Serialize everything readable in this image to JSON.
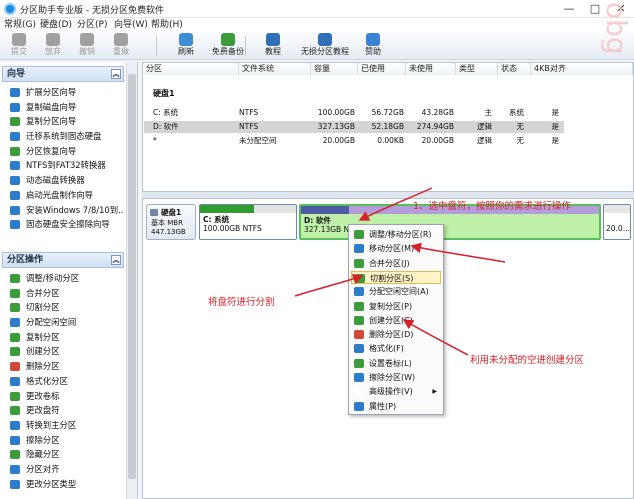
{
  "window": {
    "title": "分区助手专业版 - 无损分区免费软件",
    "controls": [
      "—",
      "□",
      "✕"
    ]
  },
  "menu": [
    "常规(G)",
    "硬盘(D)",
    "分区(P)",
    "向导(W)",
    "帮助(H)"
  ],
  "toolbar": {
    "buttons": [
      {
        "label": "提交",
        "icon": "commit-icon",
        "color": "#a0a0a0",
        "disabled": true
      },
      {
        "label": "放弃",
        "icon": "discard-icon",
        "color": "#a0a0a0",
        "disabled": true
      },
      {
        "label": "撤销",
        "icon": "undo-icon",
        "color": "#a0a0a0",
        "disabled": true
      },
      {
        "label": "重做",
        "icon": "redo-icon",
        "color": "#a0a0a0",
        "disabled": true
      },
      {
        "label": "刷新",
        "icon": "refresh-icon",
        "color": "#3a8fd6",
        "disabled": false
      },
      {
        "label": "免费备份",
        "icon": "backup-icon",
        "color": "#3c9c3c",
        "disabled": false
      },
      {
        "label": "教程",
        "icon": "tutorial-icon",
        "color": "#2f6fb5",
        "disabled": false
      },
      {
        "label": "无损分区教程",
        "icon": "partition-tutorial-icon",
        "color": "#2f6fb5",
        "disabled": false
      },
      {
        "label": "赞助",
        "icon": "heart-icon",
        "color": "#3b82d4",
        "disabled": false
      }
    ]
  },
  "sidebar": {
    "wizard_title": "向导",
    "wizard_items": [
      {
        "label": "扩展分区向导",
        "color": "#2b7cc9"
      },
      {
        "label": "复制磁盘向导",
        "color": "#2b7cc9"
      },
      {
        "label": "复制分区向导",
        "color": "#3c9c3c"
      },
      {
        "label": "迁移系统到固态硬盘",
        "color": "#2b7cc9"
      },
      {
        "label": "分区恢复向导",
        "color": "#3c9c3c"
      },
      {
        "label": "NTFS到FAT32转换器",
        "color": "#2b7cc9"
      },
      {
        "label": "动态磁盘转换器",
        "color": "#2b7cc9"
      },
      {
        "label": "启动光盘制作向导",
        "color": "#2b7cc9"
      },
      {
        "label": "安装Windows 7/8/10到...",
        "color": "#2b7cc9"
      },
      {
        "label": "固态硬盘安全擦除向导",
        "color": "#2b7cc9"
      }
    ],
    "ops_title": "分区操作",
    "ops_items": [
      {
        "label": "调整/移动分区",
        "color": "#3c9c3c"
      },
      {
        "label": "合并分区",
        "color": "#3c9c3c"
      },
      {
        "label": "切割分区",
        "color": "#3c9c3c"
      },
      {
        "label": "分配空闲空间",
        "color": "#2b7cc9"
      },
      {
        "label": "复制分区",
        "color": "#3c9c3c"
      },
      {
        "label": "创建分区",
        "color": "#3c9c3c"
      },
      {
        "label": "删除分区",
        "color": "#d04a3a"
      },
      {
        "label": "格式化分区",
        "color": "#2b7cc9"
      },
      {
        "label": "更改卷标",
        "color": "#3c9c3c"
      },
      {
        "label": "更改盘符",
        "color": "#3c9c3c"
      },
      {
        "label": "转换到主分区",
        "color": "#2b7cc9"
      },
      {
        "label": "擦除分区",
        "color": "#2b7cc9"
      },
      {
        "label": "隐藏分区",
        "color": "#3c9c3c"
      },
      {
        "label": "分区对齐",
        "color": "#2b7cc9"
      },
      {
        "label": "更改分区类型",
        "color": "#2b7cc9"
      }
    ]
  },
  "table": {
    "columns": [
      "分区",
      "文件系统",
      "容量",
      "已使用",
      "未使用",
      "类型",
      "状态",
      "4KB对齐"
    ],
    "disk_label": "硬盘1",
    "rows": [
      {
        "name": "C: 系统",
        "fs": "NTFS",
        "capacity": "100.00GB",
        "used": "56.72GB",
        "free": "43.28GB",
        "type": "主",
        "status": "系统",
        "align": "是"
      },
      {
        "name": "D: 软件",
        "fs": "NTFS",
        "capacity": "327.13GB",
        "used": "52.18GB",
        "free": "274.94GB",
        "type": "逻辑",
        "status": "无",
        "align": "是"
      },
      {
        "name": "*",
        "fs": "未分配空间",
        "capacity": "20.00GB",
        "used": "0.00KB",
        "free": "20.00GB",
        "type": "逻辑",
        "status": "无",
        "align": "是"
      }
    ]
  },
  "disk_map": {
    "disk_name": "硬盘1",
    "disk_type": "基本 MBR",
    "disk_size": "447.13GB",
    "partitions": [
      {
        "name": "C: 系统",
        "desc": "100.00GB NTFS",
        "used_fraction": 0.567,
        "bar_color": "#2f9e2f"
      },
      {
        "name": "D: 软件",
        "desc": "327.13GB NTFS",
        "used_fraction": 0.16,
        "bar_color": "#4b5ca3"
      },
      {
        "name": "",
        "desc": "20.0...",
        "used_fraction": 0.0,
        "bar_color": "#d8d8d8"
      }
    ]
  },
  "context_menu": [
    {
      "label": "调整/移动分区(R)",
      "icon": "resize-icon",
      "color": "#3c9c3c"
    },
    {
      "label": "移动分区(M)",
      "icon": "move-icon",
      "color": "#2b7cc9"
    },
    {
      "label": "合并分区(J)",
      "icon": "merge-icon",
      "color": "#3c9c3c"
    },
    {
      "label": "切割分区(S)",
      "icon": "split-icon",
      "color": "#3c9c3c"
    },
    {
      "label": "分配空闲空间(A)",
      "icon": "allocate-icon",
      "color": "#2b7cc9"
    },
    {
      "label": "复制分区(P)",
      "icon": "copy-icon",
      "color": "#3c9c3c"
    },
    {
      "label": "创建分区(C)",
      "icon": "create-icon",
      "color": "#3c9c3c"
    },
    {
      "label": "删除分区(D)",
      "icon": "delete-icon",
      "color": "#d04a3a"
    },
    {
      "label": "格式化(F)",
      "icon": "format-icon",
      "color": "#2b7cc9"
    },
    {
      "label": "设置卷标(L)",
      "icon": "label-icon",
      "color": "#3c9c3c"
    },
    {
      "label": "擦除分区(W)",
      "icon": "wipe-icon",
      "color": "#2b7cc9"
    },
    {
      "label": "高级操作(V)",
      "icon": "advanced-icon",
      "color": "#ffffff",
      "submenu": true
    },
    {
      "label": "属性(P)",
      "icon": "info-icon",
      "color": "#2b7cc9"
    }
  ],
  "annotations": {
    "step1": "1、选中盘符，按照你的需求进行操作",
    "split": "将盘符进行分割",
    "create": "利用未分配的空进创建分区",
    "arrow_color": "#d7202a"
  },
  "watermark": "obg"
}
